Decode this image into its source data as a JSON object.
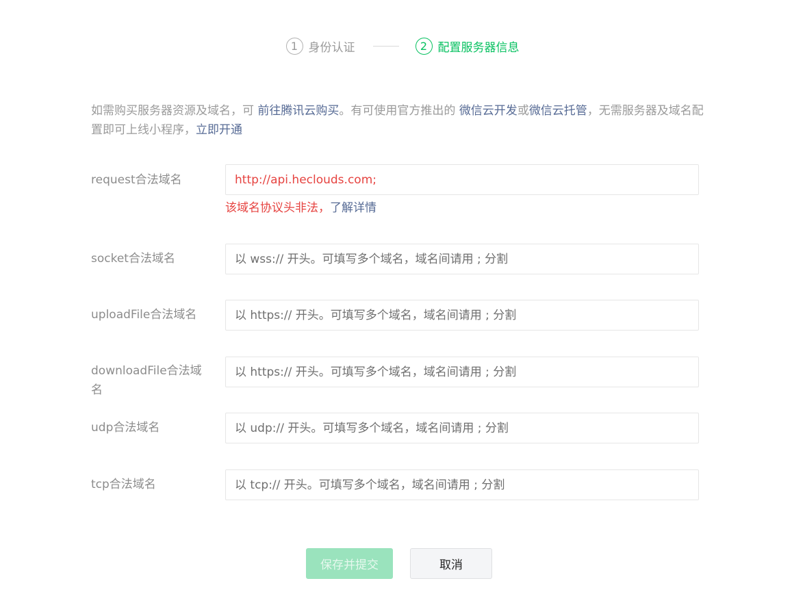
{
  "steps": [
    {
      "num": "1",
      "label": "身份认证",
      "state": "done"
    },
    {
      "num": "2",
      "label": "配置服务器信息",
      "state": "active"
    }
  ],
  "intro": {
    "text1": "如需购买服务器资源及域名，可 ",
    "link1": "前往腾讯云购买",
    "text2": "。有可使用官方推出的 ",
    "link2": "微信云开发",
    "text3": "或",
    "link3": "微信云托管",
    "text4": "，无需服务器及域名配置即可上线小程序，",
    "link4": "立即开通"
  },
  "form": {
    "request": {
      "label": "request合法域名",
      "value": "http://api.heclouds.com;",
      "error_text": "该域名协议头非法，",
      "error_link": "了解详情"
    },
    "socket": {
      "label": "socket合法域名",
      "placeholder": "以 wss:// 开头。可填写多个域名，域名间请用 ; 分割"
    },
    "uploadFile": {
      "label": "uploadFile合法域名",
      "placeholder": "以 https:// 开头。可填写多个域名，域名间请用 ; 分割"
    },
    "downloadFile": {
      "label": "downloadFile合法域名",
      "placeholder": "以 https:// 开头。可填写多个域名，域名间请用 ; 分割"
    },
    "udp": {
      "label": "udp合法域名",
      "placeholder": "以 udp:// 开头。可填写多个域名，域名间请用 ; 分割"
    },
    "tcp": {
      "label": "tcp合法域名",
      "placeholder": "以 tcp:// 开头。可填写多个域名，域名间请用 ; 分割"
    }
  },
  "buttons": {
    "submit": "保存并提交",
    "cancel": "取消"
  },
  "colors": {
    "accent": "#07c160",
    "link": "#576b95",
    "error": "#e64340",
    "disabled_primary": "#9ae3bd"
  }
}
